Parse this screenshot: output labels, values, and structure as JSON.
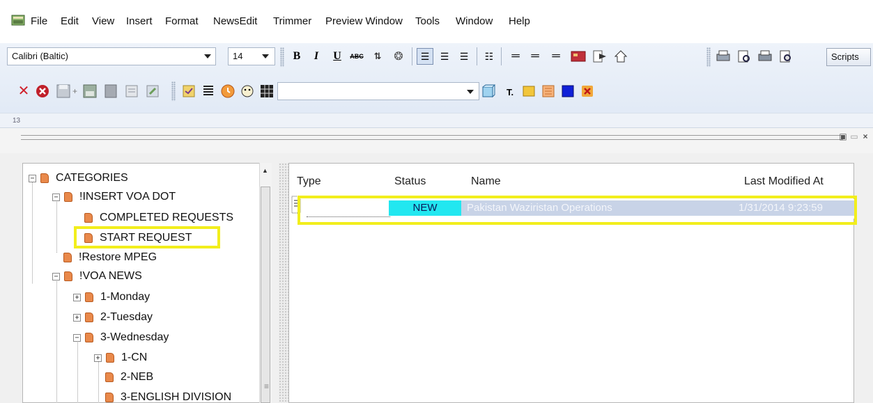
{
  "menu": {
    "items": [
      "File",
      "Edit",
      "View",
      "Insert",
      "Format",
      "NewsEdit",
      "Trimmer",
      "Preview Window",
      "Tools",
      "Window",
      "Help"
    ]
  },
  "format_toolbar": {
    "font_name": "Calibri (Baltic)",
    "font_size": "14",
    "bold_label": "B",
    "italic_label": "I",
    "underline_label": "U",
    "strike_label": "ABC",
    "scripts_label": "Scripts"
  },
  "edit_toolbar": {
    "combo_value": ""
  },
  "ruler": {
    "text": "13"
  },
  "tree": {
    "items": [
      {
        "label": "CATEGORIES",
        "expander": "−"
      },
      {
        "label": "!INSERT VOA DOT",
        "expander": "−"
      },
      {
        "label": "COMPLETED REQUESTS",
        "expander": ""
      },
      {
        "label": "START REQUEST",
        "expander": ""
      },
      {
        "label": "!Restore MPEG",
        "expander": ""
      },
      {
        "label": "!VOA NEWS",
        "expander": "−"
      },
      {
        "label": "1-Monday",
        "expander": "+"
      },
      {
        "label": "2-Tuesday",
        "expander": "+"
      },
      {
        "label": "3-Wednesday",
        "expander": "−"
      },
      {
        "label": "1-CN",
        "expander": "+"
      },
      {
        "label": "2-NEB",
        "expander": ""
      },
      {
        "label": "3-ENGLISH DIVISION",
        "expander": ""
      }
    ]
  },
  "list": {
    "columns": [
      "Type",
      "Status",
      "Name",
      "Last Modified At"
    ],
    "rows": [
      {
        "status": "NEW",
        "name": "Pakistan Waziristan Operations",
        "modified": "1/31/2014 9:23:59"
      }
    ]
  },
  "colors": {
    "highlight": "#f2ee1c",
    "status_new": "#22e7f0",
    "selection": "#c8d3e7",
    "folder": "#e9894b"
  }
}
